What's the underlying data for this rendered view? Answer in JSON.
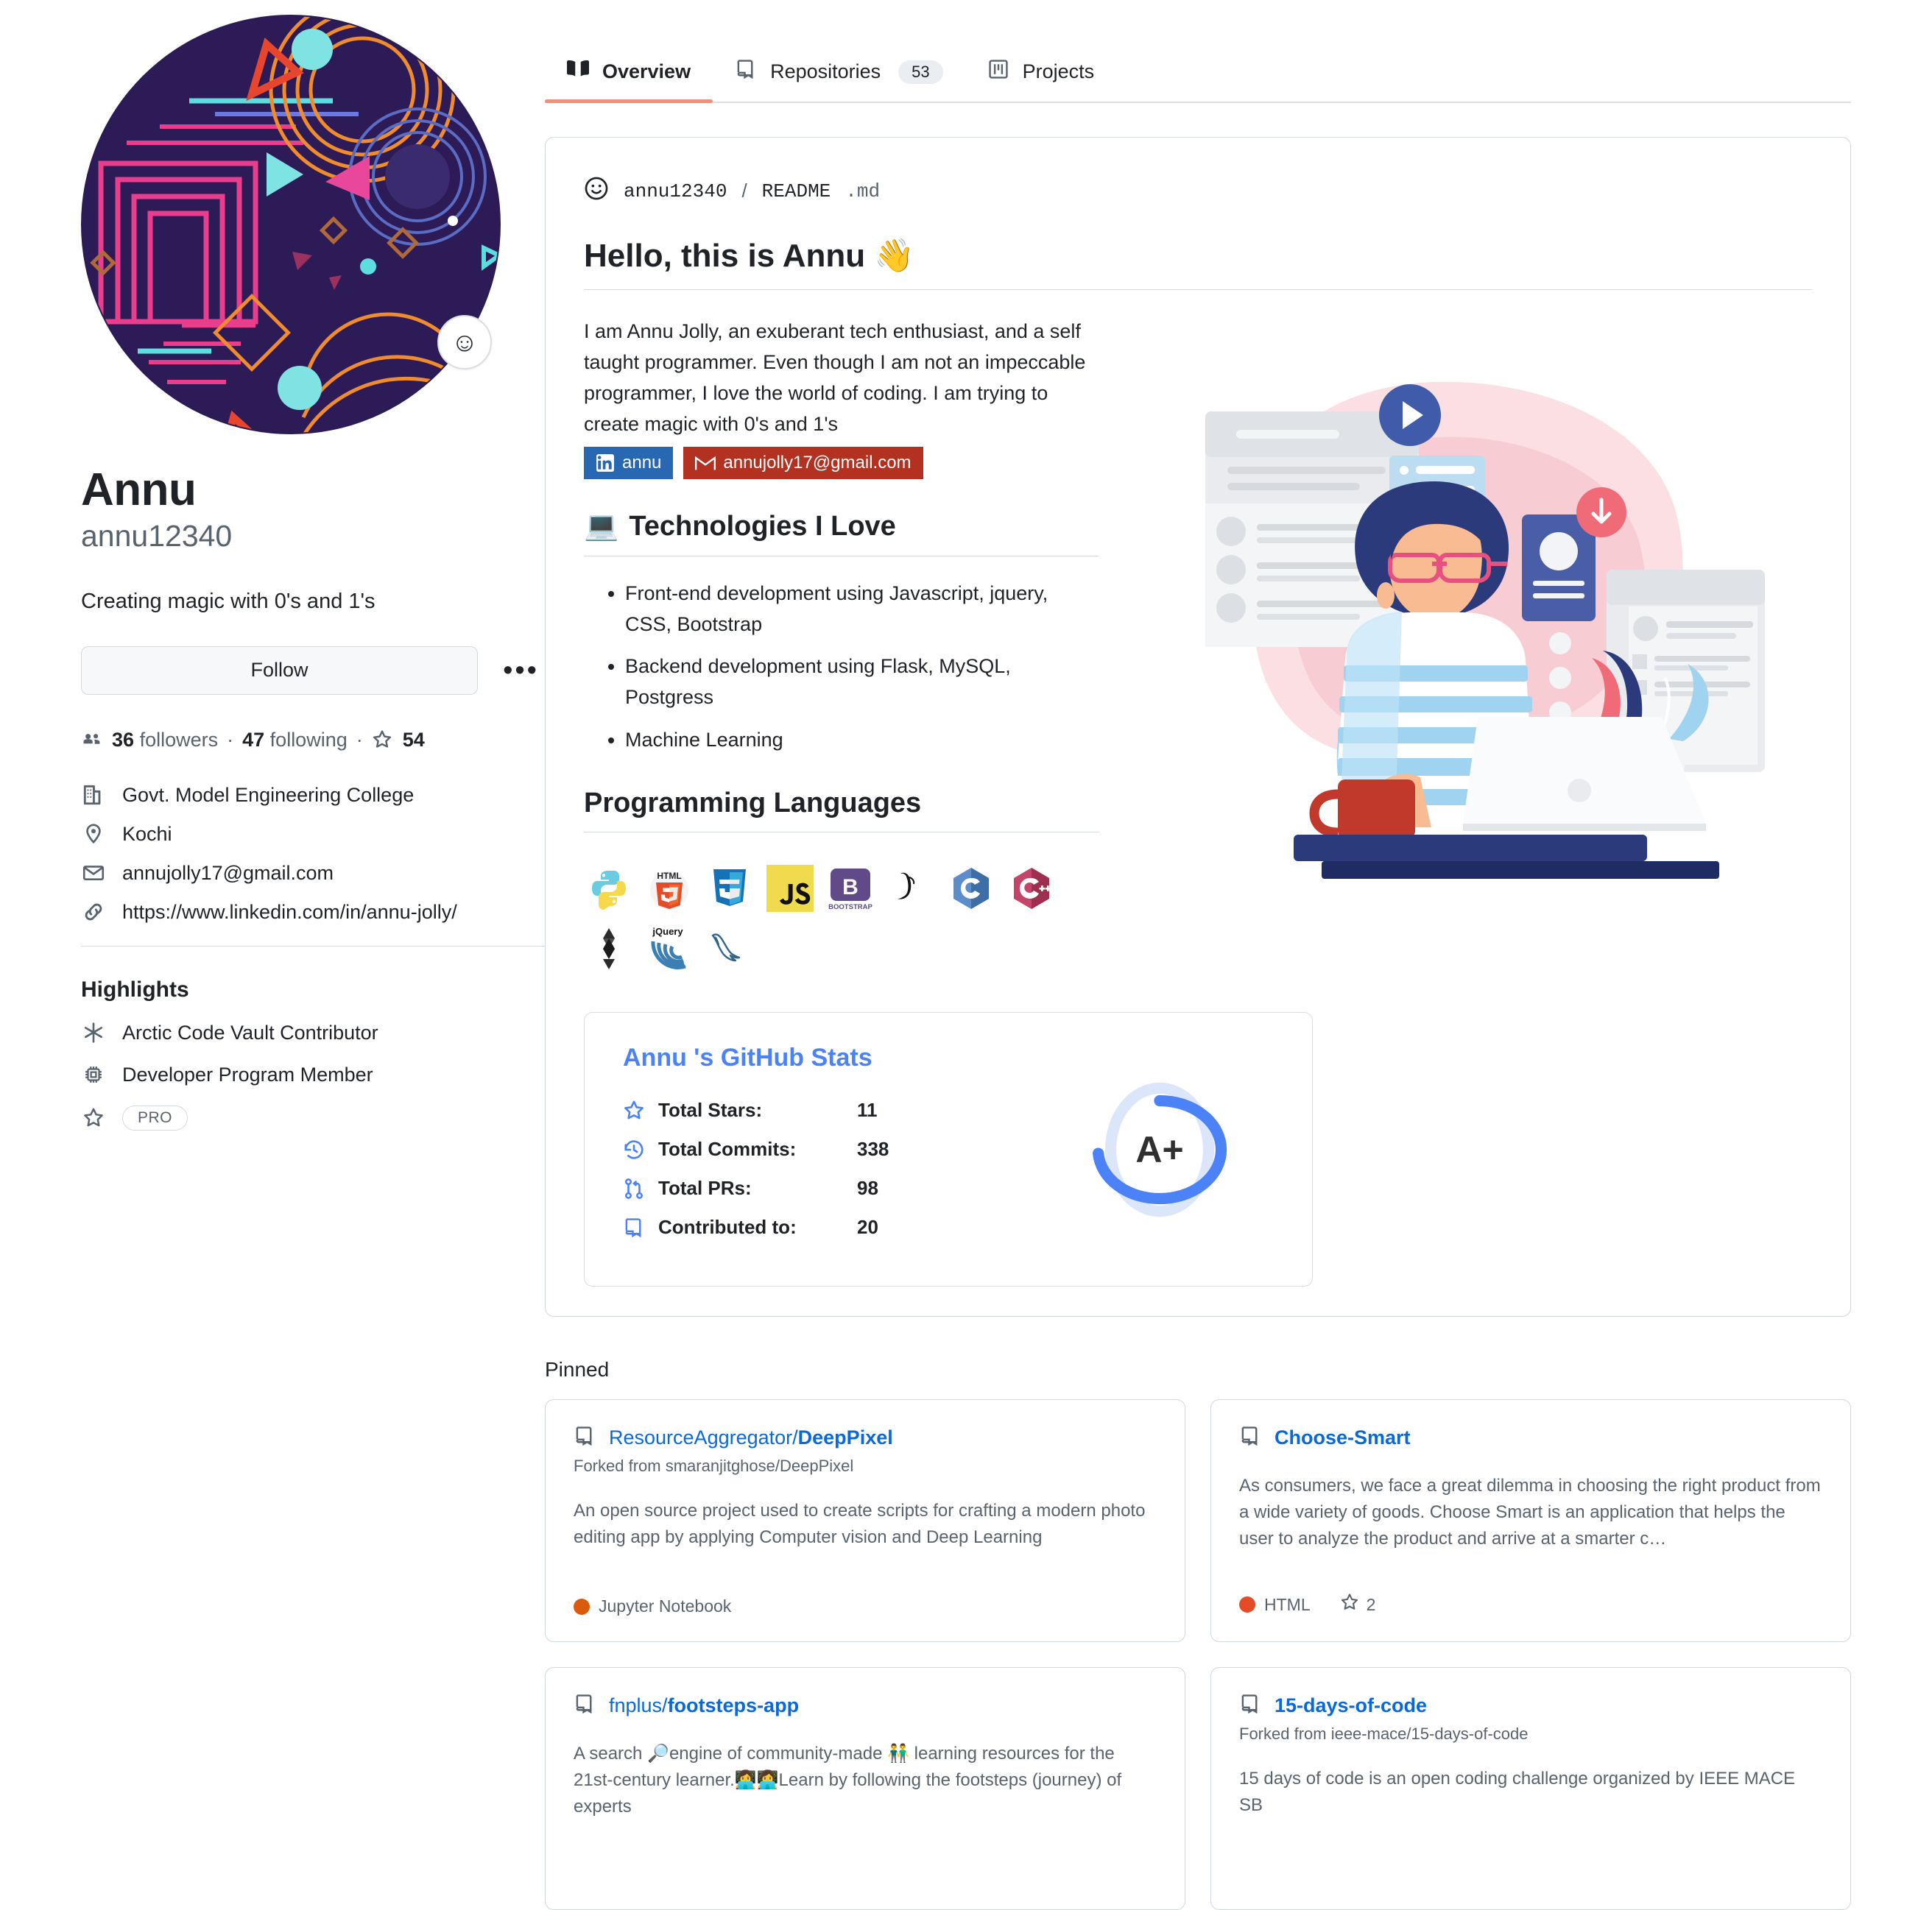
{
  "tabs": [
    {
      "label": "Overview",
      "icon": "book-icon",
      "active": true,
      "count": null
    },
    {
      "label": "Repositories",
      "icon": "repo-icon",
      "active": false,
      "count": "53"
    },
    {
      "label": "Projects",
      "icon": "project-icon",
      "active": false,
      "count": null
    }
  ],
  "profile": {
    "avatar_alt": "abstract-geometric-avatar",
    "status_emoji": "☺",
    "name": "Annu",
    "login": "annu12340",
    "bio": "Creating magic with 0's and 1's",
    "follow_label": "Follow",
    "more_label": "•••",
    "followers_count": "36",
    "followers_label": "followers",
    "following_count": "47",
    "following_label": "following",
    "stars_count": "54",
    "meta": [
      {
        "icon": "organization-icon",
        "text": "Govt. Model Engineering College"
      },
      {
        "icon": "location-icon",
        "text": "Kochi"
      },
      {
        "icon": "mail-icon",
        "text": "annujolly17@gmail.com"
      },
      {
        "icon": "link-icon",
        "text": "https://www.linkedin.com/in/annu-jolly/"
      }
    ],
    "highlights_title": "Highlights",
    "highlights": [
      {
        "icon": "arctic-vault-icon",
        "text": "Arctic Code Vault Contributor"
      },
      {
        "icon": "developer-program-icon",
        "text": "Developer Program Member"
      },
      {
        "icon": "star-icon",
        "text": "PRO",
        "pill": true
      }
    ]
  },
  "readme": {
    "owner": "annu12340",
    "slash": "/",
    "filename": "README",
    "extension": ".md",
    "heading": "Hello, this is Annu",
    "heading_emoji": "👋",
    "intro": "I am Annu Jolly, an exuberant tech enthusiast, and a self taught programmer. Even though I am not an impeccable programmer, I love the world of coding. I am trying to create magic with 0's and 1's",
    "badges": [
      {
        "name": "linkedin-badge",
        "label": "annu",
        "color": "#2867b2"
      },
      {
        "name": "gmail-badge",
        "label": "annujolly17@gmail.com",
        "color": "#b23121"
      }
    ],
    "tech_heading": "Technologies I Love",
    "tech_heading_emoji": "💻",
    "tech_items": [
      "Front-end development using Javascript, jquery, CSS, Bootstrap",
      "Backend development using Flask, MySQL, Postgress",
      "Machine Learning"
    ],
    "languages_heading": "Programming Languages",
    "language_icons": [
      "python-icon",
      "html5-icon",
      "css3-icon",
      "javascript-icon",
      "bootstrap-icon",
      "flask-icon",
      "c-icon",
      "cplusplus-icon",
      "solidity-icon",
      "jquery-icon",
      "mysql-icon"
    ],
    "illustration_alt": "woman-coding-at-laptop-illustration"
  },
  "stats_card": {
    "title": "Annu 's GitHub Stats",
    "rows": [
      {
        "icon": "star-icon",
        "label": "Total Stars:",
        "value": "11"
      },
      {
        "icon": "history-icon",
        "label": "Total Commits:",
        "value": "338"
      },
      {
        "icon": "pull-request-icon",
        "label": "Total PRs:",
        "value": "98"
      },
      {
        "icon": "repo-icon",
        "label": "Contributed to:",
        "value": "20"
      }
    ],
    "grade": "A+",
    "accent": "#4c82f7"
  },
  "pinned": {
    "title": "Pinned",
    "items": [
      {
        "owner": "ResourceAggregator/",
        "repo": "DeepPixel",
        "forked_from": "Forked from smaranjitghose/DeepPixel",
        "description": "An open source project used to create scripts for crafting a modern photo editing app by applying Computer vision and Deep Learning",
        "language": "Jupyter Notebook",
        "language_color": "#DA5B0B",
        "stars": null
      },
      {
        "owner": "",
        "repo": "Choose-Smart",
        "forked_from": "",
        "description": "As consumers, we face a great dilemma in choosing the right product from a wide variety of goods. Choose Smart is an application that helps the user to analyze the product and arrive at a smarter c…",
        "language": "HTML",
        "language_color": "#e34c26",
        "stars": "2"
      },
      {
        "owner": "fnplus/",
        "repo": "footsteps-app",
        "forked_from": "",
        "description": "A search 🔎engine of community-made 👬 learning resources for the 21st-century learner.👩‍💻👩‍💻Learn by following the footsteps (journey) of experts",
        "language": "",
        "language_color": "",
        "stars": null
      },
      {
        "owner": "",
        "repo": "15-days-of-code",
        "forked_from": "Forked from ieee-mace/15-days-of-code",
        "description": "15 days of code is an open coding challenge organized by IEEE MACE SB",
        "language": "",
        "language_color": "",
        "stars": null
      }
    ]
  }
}
